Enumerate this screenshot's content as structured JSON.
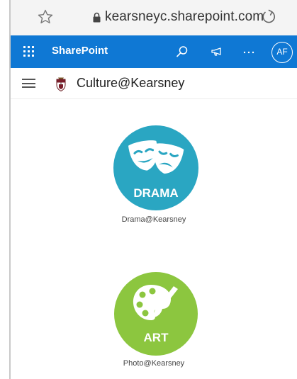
{
  "browser": {
    "url": "kearsneyc.sharepoint.com",
    "icons": {
      "bookmark": "star-icon",
      "secure": "lock-icon",
      "reload": "reload-icon"
    }
  },
  "suite_bar": {
    "brand": "SharePoint",
    "avatar_initials": "AF",
    "bg_color": "#0f78d4",
    "icons": [
      "waffle-icon",
      "search-icon",
      "megaphone-icon",
      "more-icon"
    ]
  },
  "site": {
    "title": "Culture@Kearsney",
    "icons": [
      "hamburger-icon",
      "crest-logo"
    ]
  },
  "tiles": [
    {
      "badge": "DRAMA",
      "caption": "Drama@Kearsney",
      "color": "#2aa6c2",
      "icon": "theatre-masks-icon"
    },
    {
      "badge": "ART",
      "caption": "Photo@Kearsney",
      "color": "#8cc63f",
      "icon": "palette-brush-icon"
    }
  ]
}
